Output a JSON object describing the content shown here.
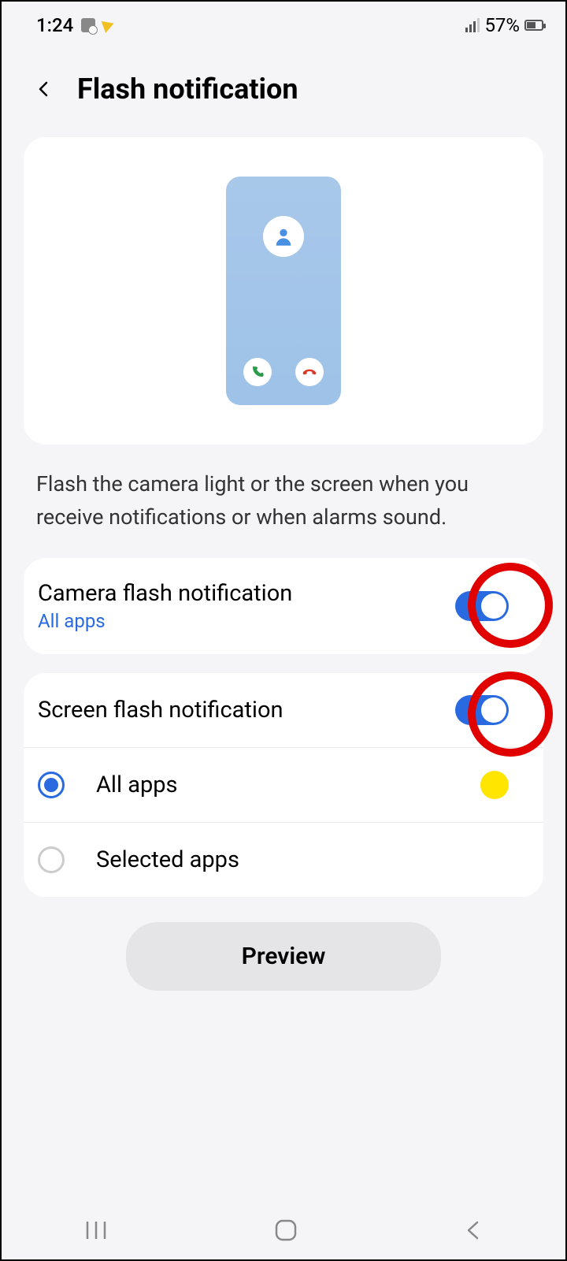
{
  "status": {
    "time": "1:24",
    "battery_pct": "57%"
  },
  "header": {
    "title": "Flash notification"
  },
  "description": "Flash the camera light or the screen when you receive notifications or when alarms sound.",
  "camera_flash": {
    "title": "Camera flash notification",
    "subtitle": "All apps",
    "enabled": true
  },
  "screen_flash": {
    "title": "Screen flash notification",
    "enabled": true,
    "options": [
      {
        "label": "All apps",
        "selected": true,
        "color": "#ffe500"
      },
      {
        "label": "Selected apps",
        "selected": false
      }
    ]
  },
  "preview_button": "Preview"
}
